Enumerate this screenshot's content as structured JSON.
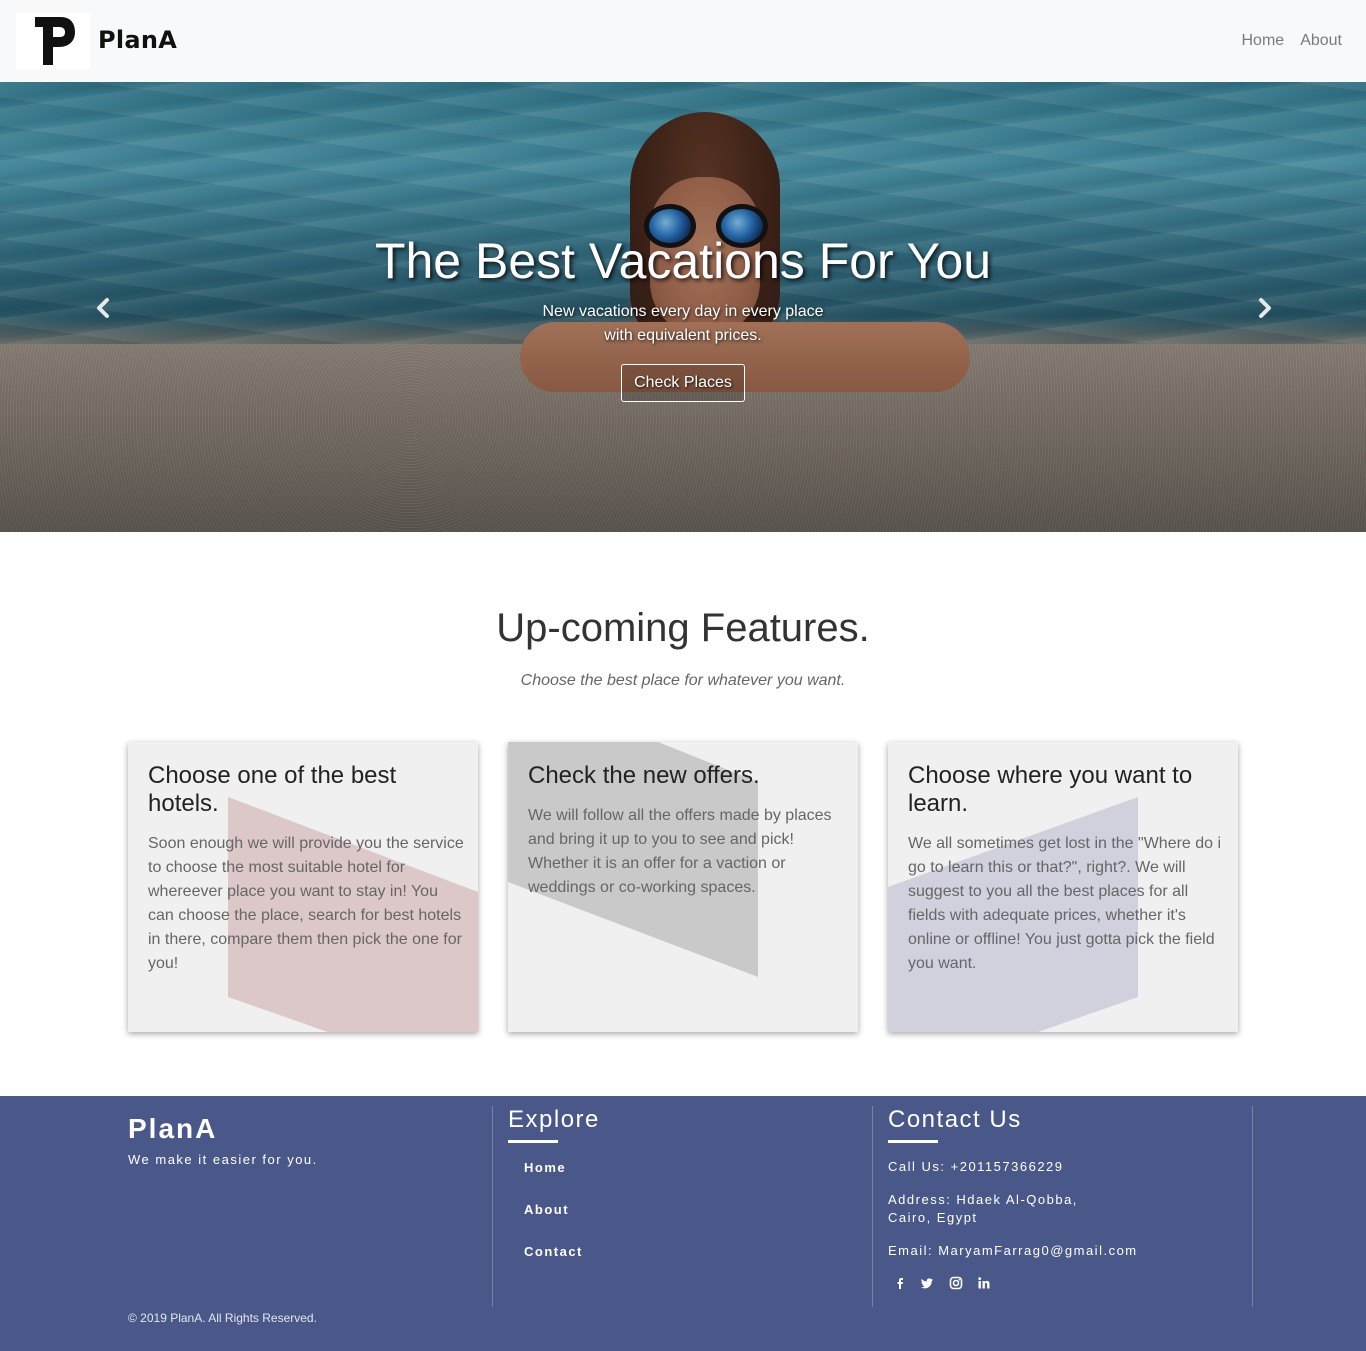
{
  "navbar": {
    "brand": "PlanA",
    "links": [
      "Home",
      "About"
    ]
  },
  "hero": {
    "title": "The Best Vacations For You",
    "subtitle_line1": "New vacations every day in every place",
    "subtitle_line2": "with equivalent prices.",
    "button_label": "Check Places"
  },
  "features": {
    "title": "Up-coming Features.",
    "subtitle": "Choose the best place for whatever you want.",
    "cards": [
      {
        "title": "Choose one of the best hotels.",
        "text": "Soon enough we will provide you the service to choose the most suitable hotel for whereever place you want to stay in! You can choose the place, search for best hotels in there, compare them then pick the one for you!",
        "shape_color": "#dcc8c8"
      },
      {
        "title": "Check the new offers.",
        "text": "We will follow all the offers made by places and bring it up to you to see and pick! Whether it is an offer for a vaction or weddings or co-working spaces.",
        "shape_color": "#c9c9c9"
      },
      {
        "title": "Choose where you want to learn.",
        "text": "We all sometimes get lost in the \"Where do i go to learn this or that?\", right?. We will suggest to you all the best places for all fields with adequate prices, whether it's online or offline! You just gotta pick the field you want.",
        "shape_color": "#d0d1dd"
      }
    ]
  },
  "footer": {
    "brand": "PlanA",
    "tagline": "We make it easier for you.",
    "explore_heading": "Explore",
    "explore_links": [
      "Home",
      "About",
      "Contact"
    ],
    "contact_heading": "Contact Us",
    "call": "Call Us: +201157366229",
    "address_line1": "Address: Hdaek Al-Qobba,",
    "address_line2": "Cairo, Egypt",
    "email": "Email: MaryamFarrag0@gmail.com",
    "social_icons": [
      "facebook-icon",
      "twitter-icon",
      "instagram-icon",
      "linkedin-icon"
    ],
    "copyright": "© 2019 PlanA. All Rights Reserved."
  },
  "colors": {
    "footer_bg": "#4a5789",
    "navbar_bg": "#f8f9fa"
  }
}
